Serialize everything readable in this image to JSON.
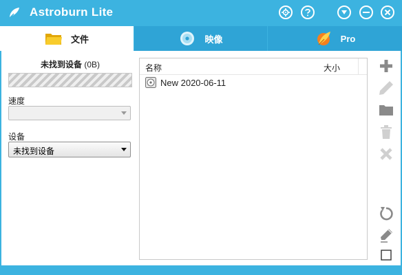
{
  "window": {
    "title": "Astroburn Lite"
  },
  "titlebar_buttons": [
    "settings-icon",
    "help-icon",
    "menu-chevron-icon",
    "minimize-icon",
    "close-icon"
  ],
  "tabs": [
    {
      "label": "文件",
      "icon": "folder-icon",
      "active": true
    },
    {
      "label": "映像",
      "icon": "disc-icon",
      "active": false
    },
    {
      "label": "Pro",
      "icon": "astroburn-pro-icon",
      "active": false
    }
  ],
  "left": {
    "device_status": "未找到设备",
    "device_size": "(0B)",
    "speed_label": "速度",
    "speed_value": "",
    "device_label": "设备",
    "device_value": "未找到设备"
  },
  "filelist": {
    "columns": {
      "name": "名称",
      "size": "大小"
    },
    "rows": [
      {
        "name": "New 2020-06-11",
        "size": ""
      }
    ]
  },
  "tools": [
    "add-icon",
    "rename-pencil-icon",
    "new-folder-icon",
    "delete-trash-icon",
    "remove-x-icon",
    "refresh-icon",
    "erase-icon",
    "checkbox-icon"
  ],
  "colors": {
    "accent": "#3cb3e0",
    "tab_inactive": "#2fa4d6",
    "tool_active": "#8a8a8a",
    "tool_disabled": "#d0d0d0"
  }
}
